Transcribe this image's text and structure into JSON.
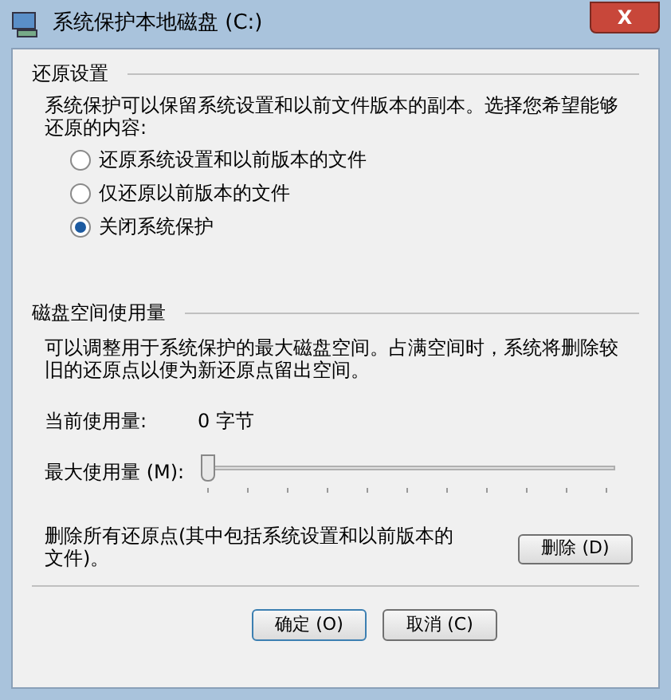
{
  "window": {
    "title": "系统保护本地磁盘 (C:)",
    "close": "X"
  },
  "restore_settings": {
    "heading": "还原设置",
    "description": "系统保护可以保留系统设置和以前文件版本的副本。选择您希望能够还原的内容:",
    "options": [
      {
        "label": "还原系统设置和以前版本的文件",
        "selected": false
      },
      {
        "label": "仅还原以前版本的文件",
        "selected": false
      },
      {
        "label": "关闭系统保护",
        "selected": true
      }
    ]
  },
  "disk_usage": {
    "heading": "磁盘空间使用量",
    "description": "可以调整用于系统保护的最大磁盘空间。占满空间时，系统将删除较旧的还原点以便为新还原点留出空间。",
    "current_label": "当前使用量:",
    "current_value": "0 字节",
    "max_label": "最大使用量 (M):",
    "max_slider": {
      "level": 0
    },
    "delete_text": "删除所有还原点(其中包括系统设置和以前版本的文件)。",
    "delete_button": "删除 (D)"
  },
  "buttons": [
    "确定 (O)",
    "取消 (C)"
  ]
}
